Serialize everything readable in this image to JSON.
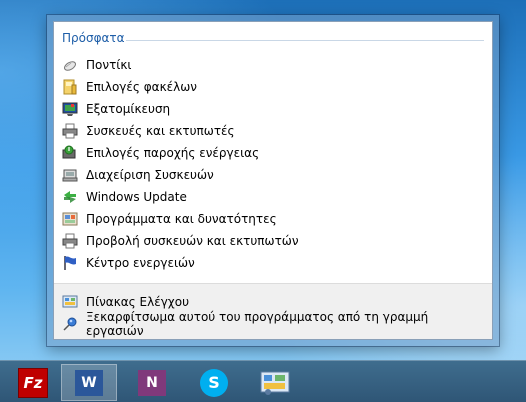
{
  "jumplist": {
    "recent_header": "Πρόσφατα",
    "recent_items": [
      {
        "label": "Ποντίκι",
        "icon": "mouse-icon"
      },
      {
        "label": "Επιλογές φακέλων",
        "icon": "folder-options-icon"
      },
      {
        "label": "Εξατομίκευση",
        "icon": "personalization-icon"
      },
      {
        "label": "Συσκευές και εκτυπωτές",
        "icon": "printer-icon"
      },
      {
        "label": "Επιλογές παροχής ενέργειας",
        "icon": "power-options-icon"
      },
      {
        "label": "Διαχείριση Συσκευών",
        "icon": "device-manager-icon"
      },
      {
        "label": "Windows Update",
        "icon": "windows-update-icon"
      },
      {
        "label": "Προγράμματα και δυνατότητες",
        "icon": "programs-icon"
      },
      {
        "label": "Προβολή συσκευών και εκτυπωτών",
        "icon": "printer-icon"
      },
      {
        "label": "Κέντρο ενεργειών",
        "icon": "action-center-flag-icon"
      }
    ],
    "tasks": [
      {
        "label": "Πίνακας Ελέγχου",
        "icon": "control-panel-icon"
      },
      {
        "label": "Ξεκαρφίτσωμα αυτού του προγράμματος από τη γραμμή εργασιών",
        "icon": "unpin-icon"
      }
    ]
  },
  "taskbar": {
    "apps": [
      {
        "name": "FileZilla",
        "icon": "filezilla-icon",
        "active": false,
        "glyph": "Fz"
      },
      {
        "name": "Word",
        "icon": "word-icon",
        "active": true,
        "glyph": "W"
      },
      {
        "name": "OneNote",
        "icon": "onenote-icon",
        "active": false,
        "glyph": "N"
      },
      {
        "name": "Skype",
        "icon": "skype-icon",
        "active": false,
        "glyph": "S"
      },
      {
        "name": "Control Panel",
        "icon": "control-panel-icon",
        "active": false,
        "glyph": ""
      }
    ]
  },
  "colors": {
    "header_text": "#1e5ea8",
    "taskbar": "#2f5676",
    "word": "#2b579a",
    "onenote": "#80397b",
    "skype": "#00aff0",
    "filezilla": "#bf0000"
  }
}
